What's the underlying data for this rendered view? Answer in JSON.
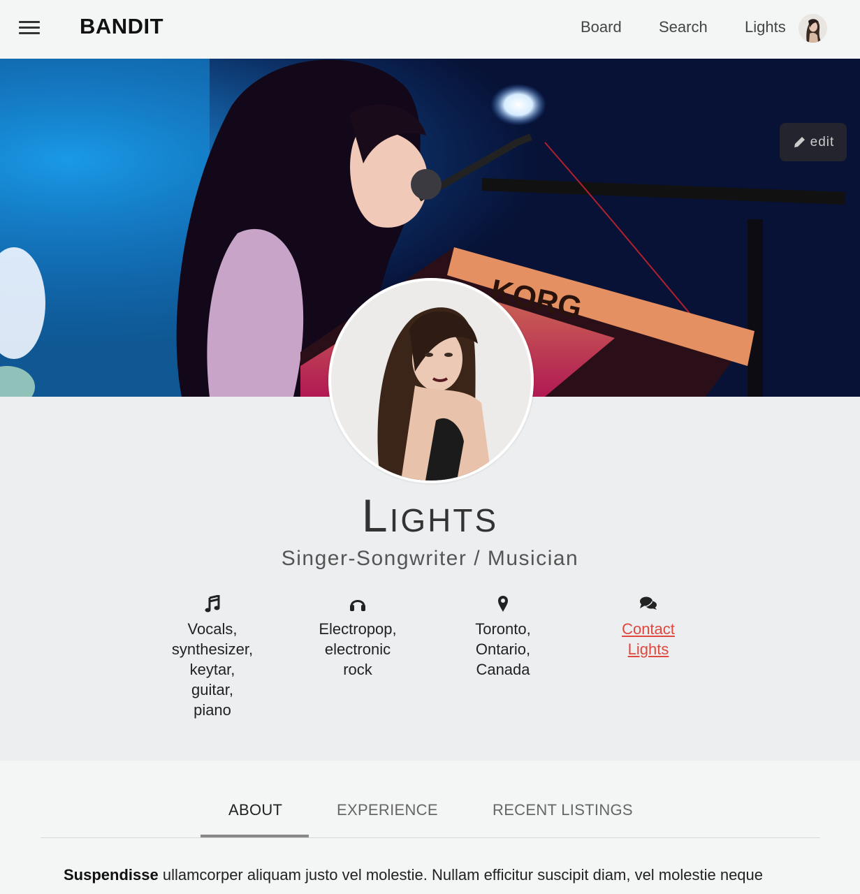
{
  "nav": {
    "brand": "BANDIT",
    "links": [
      "Board",
      "Search",
      "Lights"
    ]
  },
  "hero": {
    "edit_label": "edit"
  },
  "profile": {
    "name": "Lights",
    "role": "Singer-Songwriter / Musician",
    "facts": [
      {
        "icon": "music-note-icon",
        "lines": [
          "Vocals,",
          "synthesizer,",
          "keytar,",
          "guitar,",
          "piano"
        ]
      },
      {
        "icon": "headphones-icon",
        "lines": [
          "Electropop,",
          "electronic",
          "rock"
        ]
      },
      {
        "icon": "map-marker-icon",
        "lines": [
          "Toronto,",
          "Ontario,",
          "Canada"
        ]
      },
      {
        "icon": "chat-bubbles-icon",
        "lines": [
          "Contact",
          "Lights"
        ],
        "link": true
      }
    ]
  },
  "tabs": [
    "ABOUT",
    "EXPERIENCE",
    "RECENT LISTINGS"
  ],
  "about": {
    "lead": "Suspendisse",
    "text": " ullamcorper aliquam justo vel molestie. Nullam efficitur suscipit diam, vel molestie neque"
  },
  "colors": {
    "accent": "#e0473d",
    "nav_bg": "#f4f5f5",
    "profile_bg": "#eceef0"
  }
}
